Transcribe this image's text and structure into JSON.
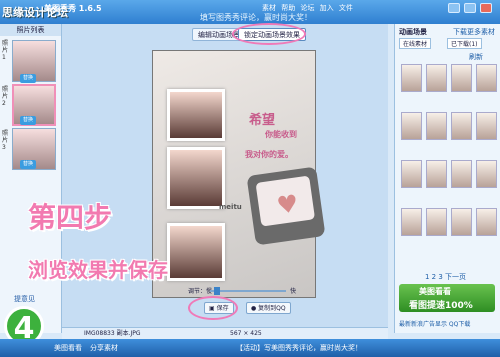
{
  "titlebar": {
    "watermark": "思缘设计论坛",
    "app_name": "美图秀秀 1.6.5",
    "tip": "填写图秀秀评论，赢时尚大奖！",
    "menus": "素材 帮助 论坛 加入 文件"
  },
  "left_panel": {
    "header": "照片列表",
    "slots": [
      "照片1",
      "照片2",
      "照片3"
    ],
    "replace_label": "替换",
    "hint": "提意见"
  },
  "tabs": {
    "edit": "编辑动画场景",
    "lock": "锁定动画场景效果"
  },
  "poem": {
    "line1": "希望",
    "line2": "你能收到",
    "line3": "我对你的爱。",
    "brand": "meitu"
  },
  "controls": {
    "speed_label": "调节：慢",
    "speed_fast": "快",
    "save": "保存",
    "copy": "复制到QQ"
  },
  "status_bar": {
    "filename": "IMG08833 副本.JPG",
    "dims": "567 × 425"
  },
  "right_panel": {
    "title": "动画场景",
    "download": "下载更多素材",
    "tab_online": "在线素材",
    "tab_downloaded": "已下载(1)",
    "refresh": "刷新",
    "pager": "1 2 3 下一页",
    "ad_line1": "美图看看",
    "ad_line2": "看图提速100%",
    "latest": "最新新浪广告显示 QQ下载"
  },
  "overlay": {
    "title": "第四步",
    "subtitle": "浏览效果并保存",
    "step_number": "4"
  },
  "taskbar": {
    "app": "美图看看",
    "share": "分享素材",
    "notice": "【活动】写美图秀秀评论，赢时尚大奖！"
  }
}
